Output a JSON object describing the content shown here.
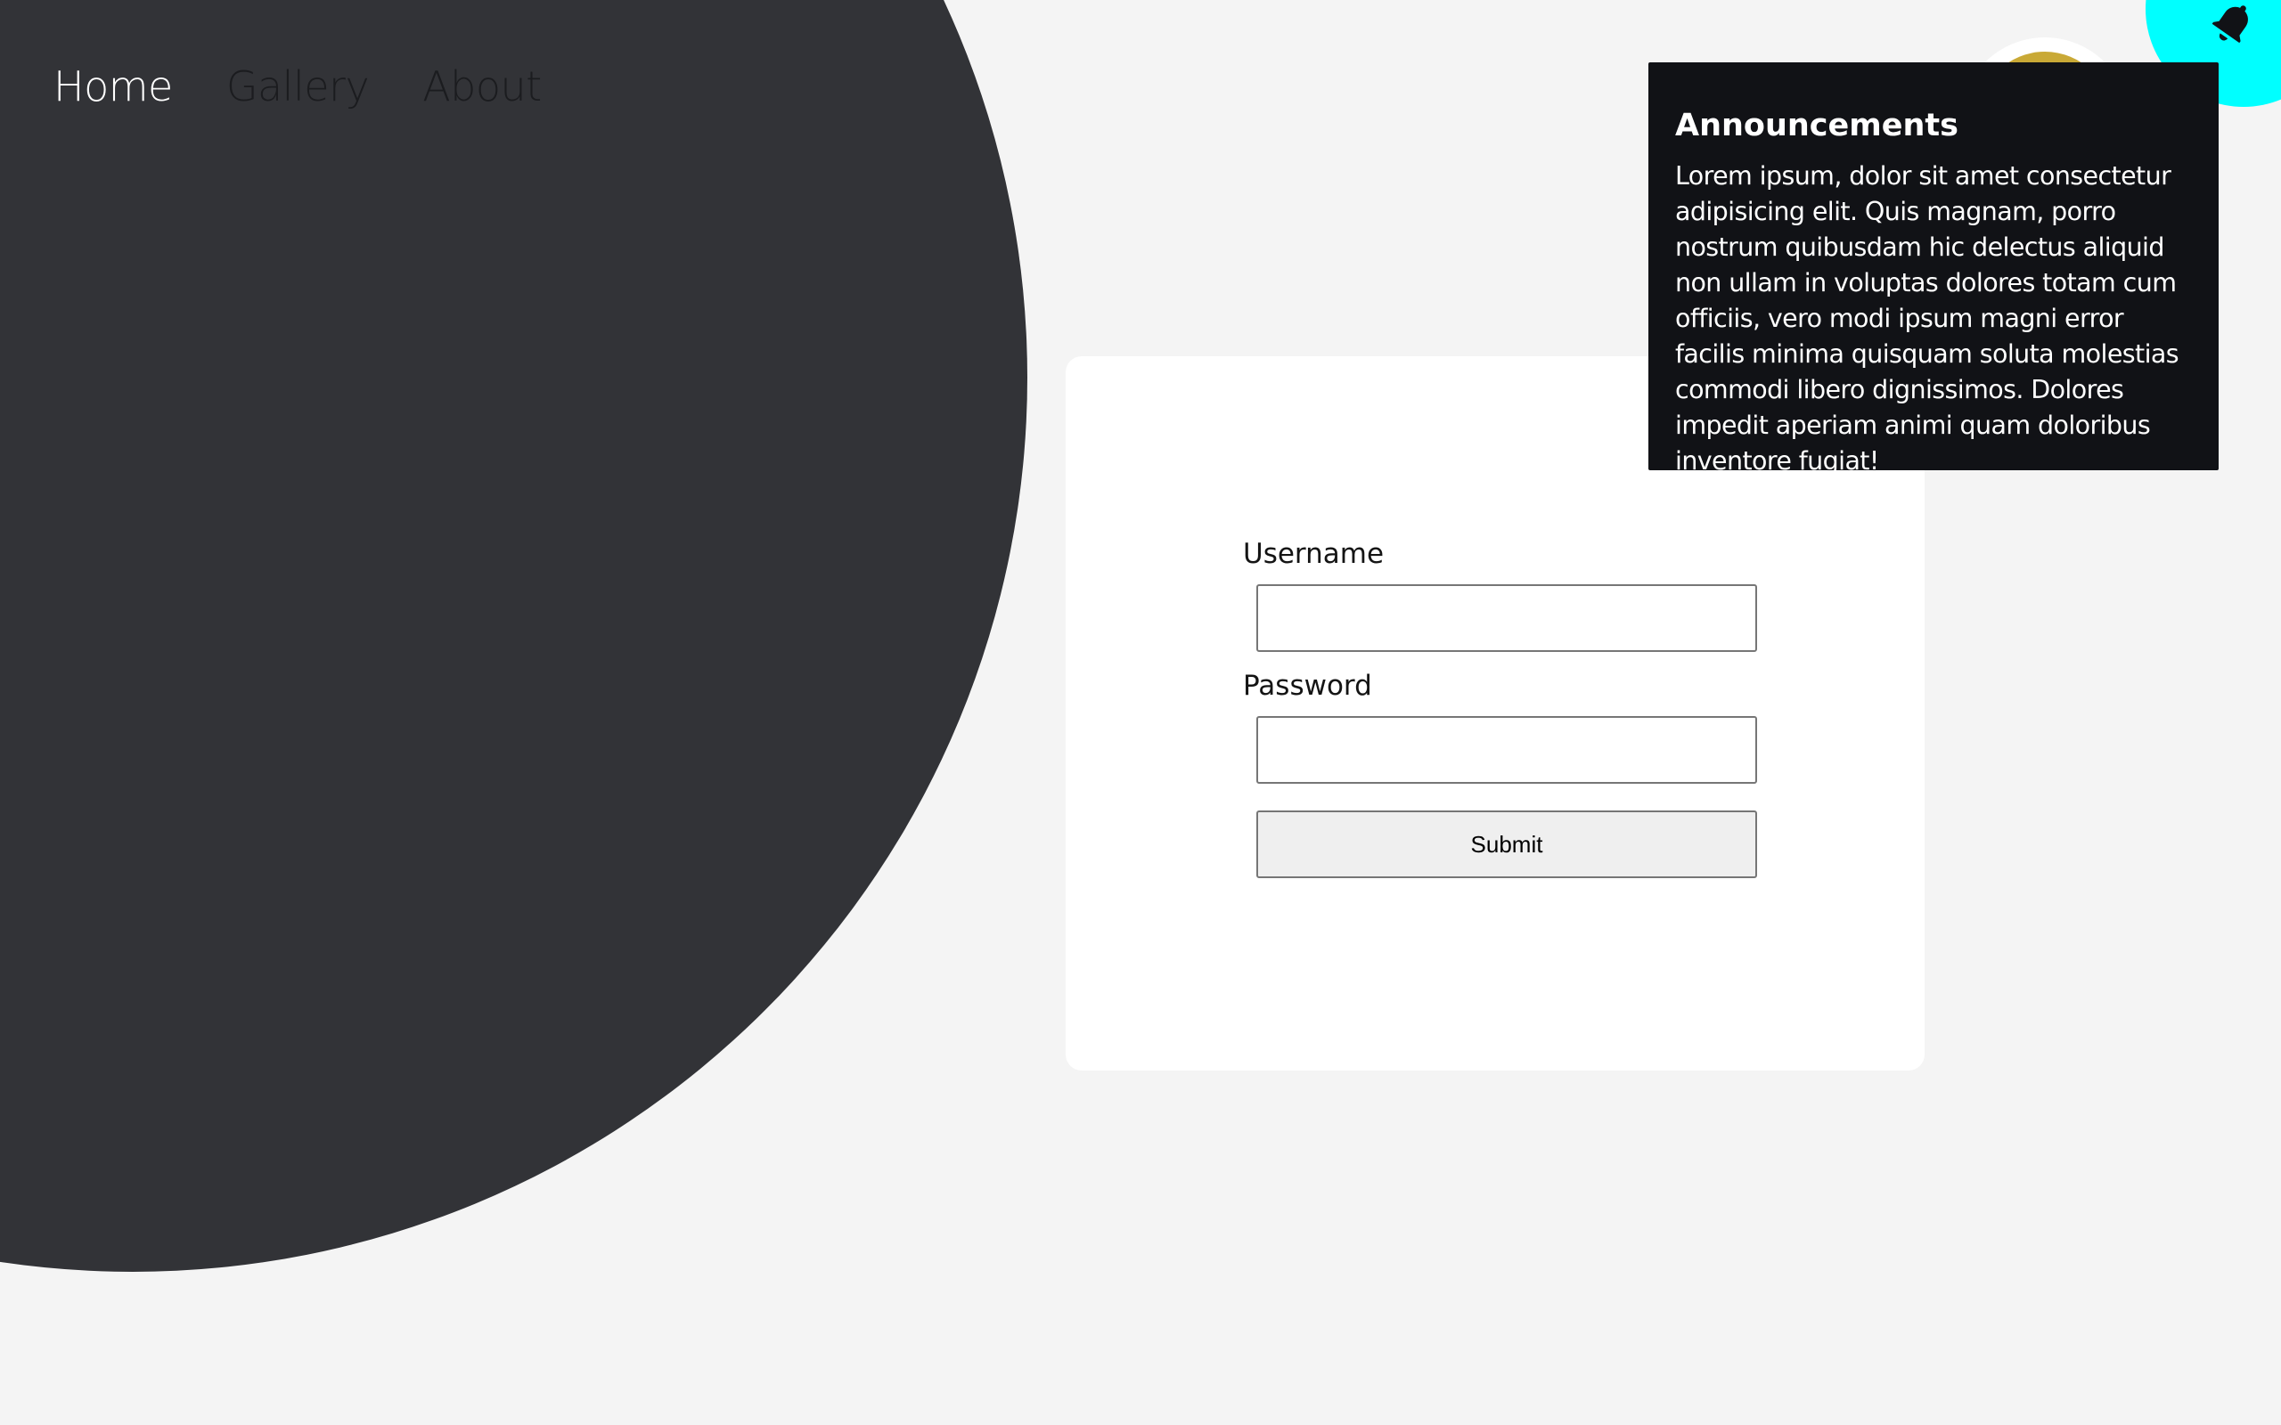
{
  "nav": {
    "items": [
      {
        "label": "Home",
        "active": true
      },
      {
        "label": "Gallery",
        "active": false
      },
      {
        "label": "About",
        "active": false
      }
    ]
  },
  "login": {
    "username_label": "Username",
    "username_value": "",
    "password_label": "Password",
    "password_value": "",
    "submit_label": "Submit"
  },
  "announcement": {
    "title": "Announcements",
    "body": "Lorem ipsum, dolor sit amet consectetur adipisicing elit. Quis magnam, porro nostrum quibusdam hic delectus aliquid non ullam in voluptas dolores totam cum officiis, vero modi ipsum magni error facilis minima quisquam soluta molestias commodi libero dignissimos. Dolores impedit aperiam animi quam doloribus inventore fugiat!"
  },
  "icons": {
    "notification": "bell-icon"
  },
  "colors": {
    "background": "#f4f4f4",
    "dark_circle": "#323337",
    "announcement_bg": "#111216",
    "cyan_accent": "#00ffff",
    "gold_accent": "#c9a936"
  }
}
